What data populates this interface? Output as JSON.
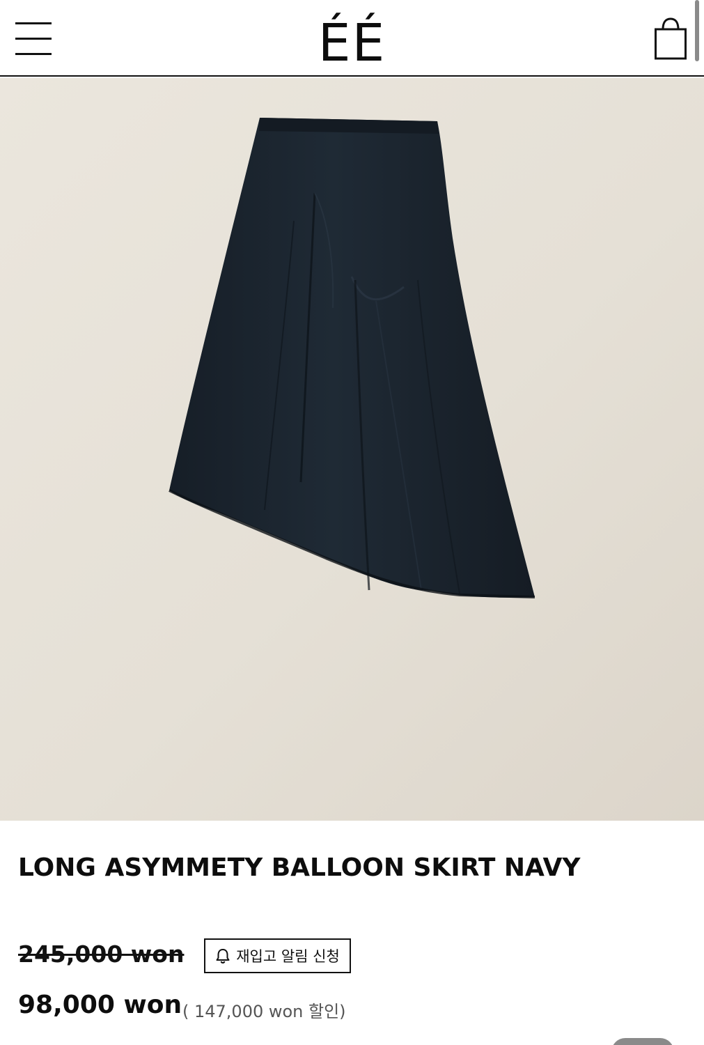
{
  "header": {
    "logo": "ÉÉ",
    "menu_icon": "hamburger-menu-icon",
    "cart_icon": "shopping-bag-icon"
  },
  "product": {
    "image_alt": "LONG ASYMMETY BALLOON SKIRT NAVY",
    "image_background": "#e7e2d9",
    "garment_color": "#1c2530",
    "title": "LONG ASYMMETY BALLOON SKIRT NAVY",
    "original_price": "245,000 won",
    "restock_button": {
      "icon": "bell-icon",
      "label": "재입고 알림 신청"
    },
    "sale_price": "98,000 won",
    "discount_note": "( 147,000 won 할인)"
  }
}
